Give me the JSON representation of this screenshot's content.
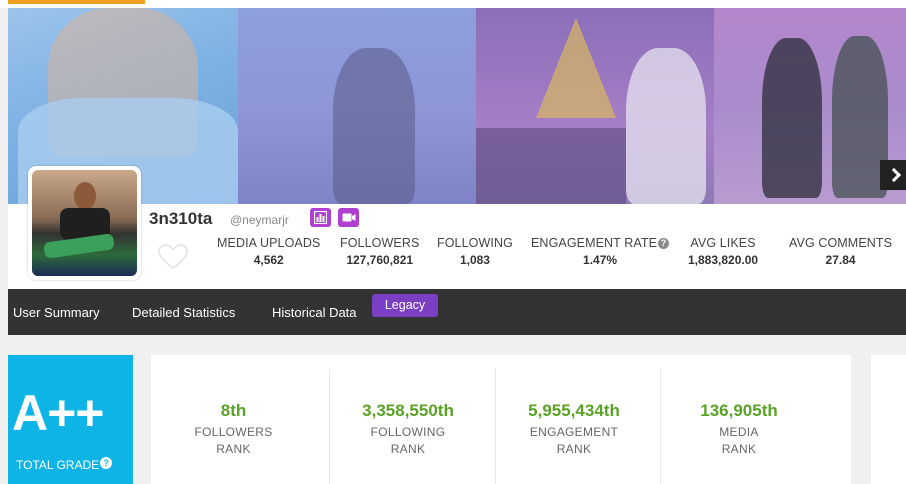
{
  "profile": {
    "username": "3n310ta",
    "handle": "@neymarjr",
    "badges": [
      "chart-icon",
      "video-icon"
    ]
  },
  "stats": [
    {
      "label": "MEDIA UPLOADS",
      "value": "4,562"
    },
    {
      "label": "FOLLOWERS",
      "value": "127,760,821"
    },
    {
      "label": "FOLLOWING",
      "value": "1,083"
    },
    {
      "label": "ENGAGEMENT RATE",
      "value": "1.47%"
    },
    {
      "label": "AVG LIKES",
      "value": "1,883,820.00"
    },
    {
      "label": "AVG COMMENTS",
      "value": "27.84"
    }
  ],
  "nav": {
    "items": [
      "User Summary",
      "Detailed Statistics",
      "Historical Data"
    ],
    "legacy": "Legacy"
  },
  "grade": {
    "value": "A++",
    "label": "TOTAL GRADE"
  },
  "ranks": [
    {
      "value": "8th",
      "line1": "FOLLOWERS",
      "line2": "RANK"
    },
    {
      "value": "3,358,550th",
      "line1": "FOLLOWING",
      "line2": "RANK"
    },
    {
      "value": "5,955,434th",
      "line1": "ENGAGEMENT",
      "line2": "RANK"
    },
    {
      "value": "136,905th",
      "line1": "MEDIA",
      "line2": "RANK"
    }
  ],
  "colors": {
    "accent_purple": "#b040d0",
    "legacy_purple": "#7b3fc4",
    "grade_blue": "#0fb4e6",
    "rank_green": "#5aa225",
    "nav_dark": "#333333"
  }
}
